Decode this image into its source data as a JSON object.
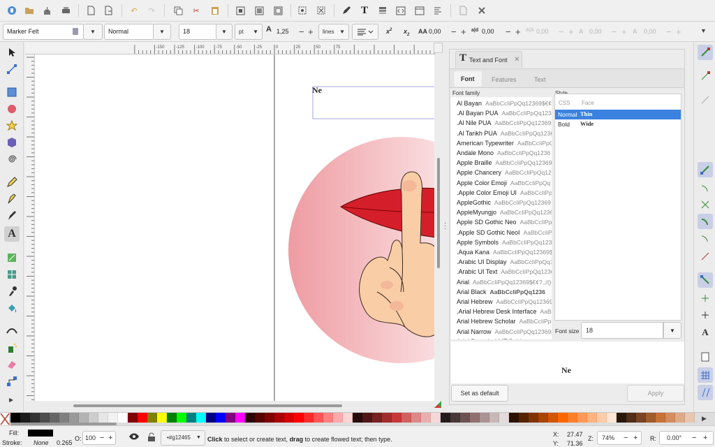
{
  "command_bar": {
    "icons": [
      "new-document-icon",
      "open-file-icon",
      "save-icon",
      "print-icon",
      "import-icon",
      "export-icon",
      "undo-icon",
      "redo-icon",
      "copy-icon",
      "cut-icon",
      "paste-icon",
      "zoom-selection-icon",
      "zoom-drawing-icon",
      "zoom-page-icon",
      "duplicate-icon",
      "clone-icon",
      "unlink-clone-icon",
      "group-icon",
      "ungroup-icon",
      "fill-stroke-icon",
      "text-font-icon",
      "layers-icon",
      "xml-editor-icon",
      "align-icon",
      "preferences-icon"
    ]
  },
  "tool_controls": {
    "font_family": "Marker Felt",
    "font_style": "Normal",
    "font_size": "18",
    "unit": "pt",
    "line_spacing": "1,25",
    "spacing_mode": "lines",
    "letter_spacing": "0,00",
    "word_spacing": "0,00",
    "kerning": "0,00",
    "vertical_shift": "0,00",
    "rotation": "0,00",
    "plus": "+",
    "minus": "−",
    "aa_label": "AA",
    "aa_sub": "a|d",
    "a_sub": "A|A",
    "x_sup": "x",
    "x_sub": "x"
  },
  "ruler": {
    "labels": [
      "-150",
      "-125",
      "-100",
      "-75",
      "-50",
      "-25",
      "0",
      "25",
      "50",
      "75"
    ]
  },
  "canvas": {
    "text_object": "Ne"
  },
  "dock": {
    "tab_title": "Text and Font",
    "subtabs": [
      "Font",
      "Features",
      "Text"
    ],
    "family_header": "Font family",
    "style_header": "Style",
    "col_css": "CSS",
    "col_face": "Face",
    "styles": [
      {
        "css": "Normal",
        "face": "Thin",
        "selected": true
      },
      {
        "css": "Bold",
        "face": "Wide",
        "selected": false
      }
    ],
    "font_size_label": "Font size",
    "font_size_value": "18",
    "preview": "Ne",
    "set_default": "Set as default",
    "apply": "Apply",
    "fonts": [
      {
        "name": "Al Bayan",
        "sample": "AaBbCcIiPpQq12369$€¢"
      },
      {
        "name": ".Al Bayan PUA",
        "sample": "AaBbCcIiPpQq12369"
      },
      {
        "name": ".Al Nile PUA",
        "sample": "AaBbCcIiPpQq12369$"
      },
      {
        "name": ".Al Tarikh PUA",
        "sample": "AaBbCcIiPpQq12369"
      },
      {
        "name": "American Typewriter",
        "sample": "AaBbCcIiPpQq"
      },
      {
        "name": "Andale Mono",
        "sample": "AaBbCcIiPpQq1236"
      },
      {
        "name": "Apple Braille",
        "sample": "AaBbCcIiPpQq12369"
      },
      {
        "name": "Apple Chancery",
        "sample": "AaBbCcIiPpQq123"
      },
      {
        "name": "Apple Color Emoji",
        "sample": "AaBbCcIiPpQq"
      },
      {
        "name": ".Apple Color Emoji UI",
        "sample": "AaBbCcIiPpQ"
      },
      {
        "name": "AppleGothic",
        "sample": "AaBbCcIiPpQq12369"
      },
      {
        "name": "AppleMyungjo",
        "sample": "AaBbCcIiPpQq1236"
      },
      {
        "name": "Apple SD Gothic Neo",
        "sample": "AaBbCcIiPpQq1"
      },
      {
        "name": ".Apple SD Gothic NeoI",
        "sample": "AaBbCcIiPp"
      },
      {
        "name": "Apple Symbols",
        "sample": "AaBbCcIiPpQq12369$€¢?"
      },
      {
        "name": ".Aqua Kana",
        "sample": "AaBbCcIiPpQq12369$"
      },
      {
        "name": ".Arabic UI Display",
        "sample": "AaBbCcIiPpQq12"
      },
      {
        "name": ".Arabic UI Text",
        "sample": "AaBbCcIiPpQq1236"
      },
      {
        "name": "Arial",
        "sample": "AaBbCcIiPpQq12369$€¢?.;/()"
      },
      {
        "name": "Arial Black",
        "sample": "AaBbCcIiPpQq1236"
      },
      {
        "name": "Arial Hebrew",
        "sample": "AaBbCcIiPpQq12369$€"
      },
      {
        "name": ".Arial Hebrew Desk Interface",
        "sample": "AaBbC"
      },
      {
        "name": "Arial Hebrew Scholar",
        "sample": "AaBbCcIiPpQ"
      },
      {
        "name": "Arial Narrow",
        "sample": "AaBbCcIiPpQq12369$€¢?."
      },
      {
        "name": "Arial Rounded MT Bold",
        "sample": "AaBbCcIiP"
      }
    ]
  },
  "status": {
    "fill_label": "Fill:",
    "stroke_label": "Stroke:",
    "stroke_value": "None",
    "stroke_width": "0.265",
    "opacity_label": "O:",
    "opacity_value": "100",
    "layer": "•#g12465",
    "message_b1": "Click",
    "message_1": " to select or create text, ",
    "message_b2": "drag",
    "message_2": " to create flowed text; then type.",
    "x_label": "X:",
    "x_value": "27.47",
    "y_label": "Y:",
    "y_value": "71.36",
    "z_label": "Z:",
    "zoom": "74%",
    "r_label": "R:",
    "rotation": "0.00°"
  },
  "palette_colors": [
    "#000000",
    "#1a1a1a",
    "#333333",
    "#4d4d4d",
    "#666666",
    "#808080",
    "#999999",
    "#b3b3b3",
    "#cccccc",
    "#e6e6e6",
    "#f2f2f2",
    "#ffffff",
    "#800000",
    "#ff0000",
    "#808000",
    "#ffff00",
    "#008000",
    "#00ff00",
    "#008080",
    "#00ffff",
    "#000080",
    "#0000ff",
    "#800080",
    "#ff00ff",
    "#2b0000",
    "#550000",
    "#800000",
    "#aa0000",
    "#d40000",
    "#ff0000",
    "#ff2a2a",
    "#ff5555",
    "#ff8080",
    "#ffaaaa",
    "#ffd5d5",
    "#280b0b",
    "#501616",
    "#782121",
    "#a02c2c",
    "#c83737",
    "#d35f5f",
    "#de8787",
    "#e9afaf",
    "#f4d7d7",
    "#241c1c",
    "#483737",
    "#6c5353",
    "#916f6f",
    "#ac9393",
    "#c8b7b7",
    "#e3dbdb",
    "#2b1100",
    "#552200",
    "#803300",
    "#aa4400",
    "#d45500",
    "#ff6600",
    "#ff7f2a",
    "#ff9955",
    "#ffb380",
    "#ffccaa",
    "#ffe6d5",
    "#28170b",
    "#502d16",
    "#784421",
    "#a05a2c",
    "#c87137",
    "#d38d5f",
    "#deaa87",
    "#e9c6af"
  ]
}
